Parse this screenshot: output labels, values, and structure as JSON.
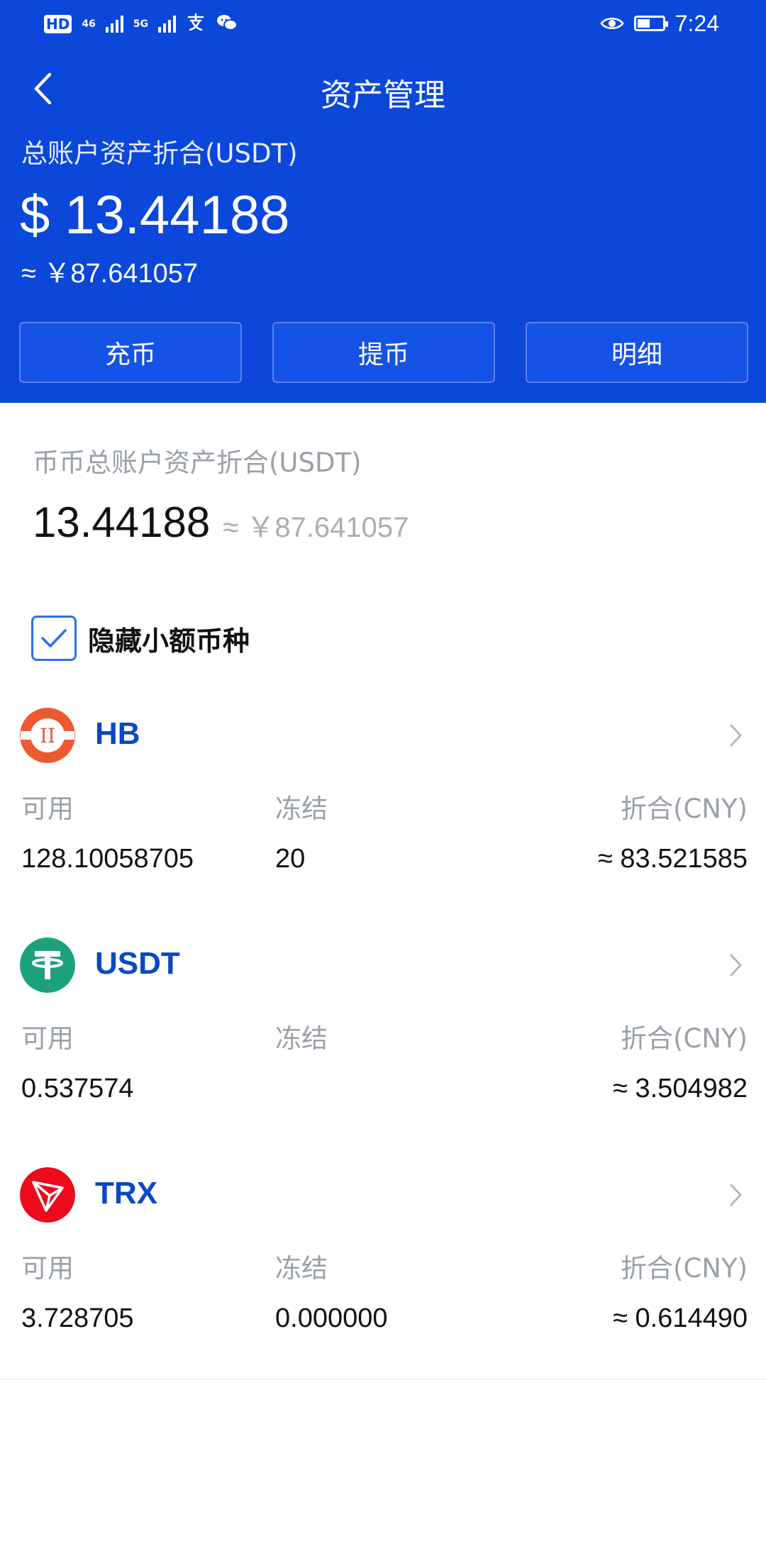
{
  "status_bar": {
    "hd_label": "HD",
    "sim1_label": "46",
    "sim2_label": "5G",
    "time": "7:24",
    "battery_level": 0.5
  },
  "nav": {
    "title": "资产管理",
    "back_icon": "chevron-left-icon"
  },
  "summary": {
    "label": "总账户资产折合(USDT)",
    "usd_value": "$ 13.44188",
    "cny_value": "≈ ￥87.641057"
  },
  "actions": {
    "deposit": "充币",
    "withdraw": "提币",
    "details": "明细"
  },
  "spot": {
    "label": "币币总账户资产折合(USDT)",
    "usd_value": "13.44188",
    "cny_value": "≈ ￥87.641057"
  },
  "filter": {
    "hide_small_label": "隐藏小额币种",
    "hide_small_checked": true
  },
  "coins": [
    {
      "name": "HB",
      "available_label": "可用",
      "frozen_label": "冻结",
      "value_label": "折合(CNY)",
      "available": "128.10058705",
      "frozen": "20",
      "value": "≈ 83.521585",
      "logo_color": "#ee5a30"
    },
    {
      "name": "USDT",
      "available_label": "可用",
      "frozen_label": "冻结",
      "value_label": "折合(CNY)",
      "available": "0.537574",
      "frozen": "",
      "value": "≈ 3.504982",
      "logo_color": "#1ba27a"
    },
    {
      "name": "TRX",
      "available_label": "可用",
      "frozen_label": "冻结",
      "value_label": "折合(CNY)",
      "available": "3.728705",
      "frozen": "0.000000",
      "value": "≈ 0.614490",
      "logo_color": "#ec0a1c"
    }
  ],
  "colors": {
    "header_bg": "#0b47d9",
    "coin_name": "#0b48c4",
    "checkbox": "#2b72de"
  }
}
